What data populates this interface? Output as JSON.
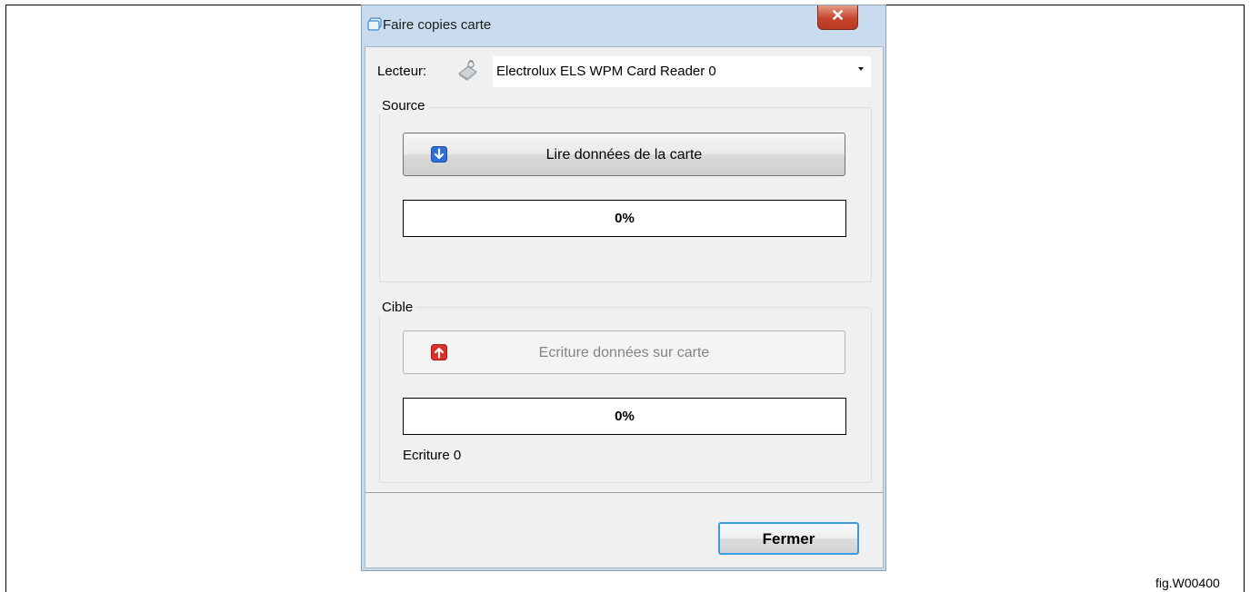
{
  "window": {
    "title": "Faire copies carte"
  },
  "reader": {
    "label": "Lecteur:",
    "selected": "Electrolux ELS WPM Card Reader 0"
  },
  "source": {
    "group_label": "Source",
    "read_button_label": "Lire données de la carte",
    "progress": {
      "value": 0,
      "text": "0%"
    }
  },
  "target": {
    "group_label": "Cible",
    "write_button_label": "Ecriture données sur carte",
    "write_button_enabled": false,
    "progress": {
      "value": 0,
      "text": "0%"
    },
    "status": "Ecriture 0"
  },
  "footer": {
    "close_label": "Fermer"
  },
  "figure_label": "fig.W00400",
  "icons": {
    "window": "window-icon",
    "reader": "card-reader-icon",
    "read": "arrow-down-icon",
    "write": "arrow-up-icon",
    "close": "close-icon",
    "dropdown": "chevron-down-icon"
  },
  "colors": {
    "read_icon": "#2f6fd6",
    "write_icon": "#d9302a",
    "close_button": "#c6442c",
    "focus_border": "#3c9be0"
  }
}
